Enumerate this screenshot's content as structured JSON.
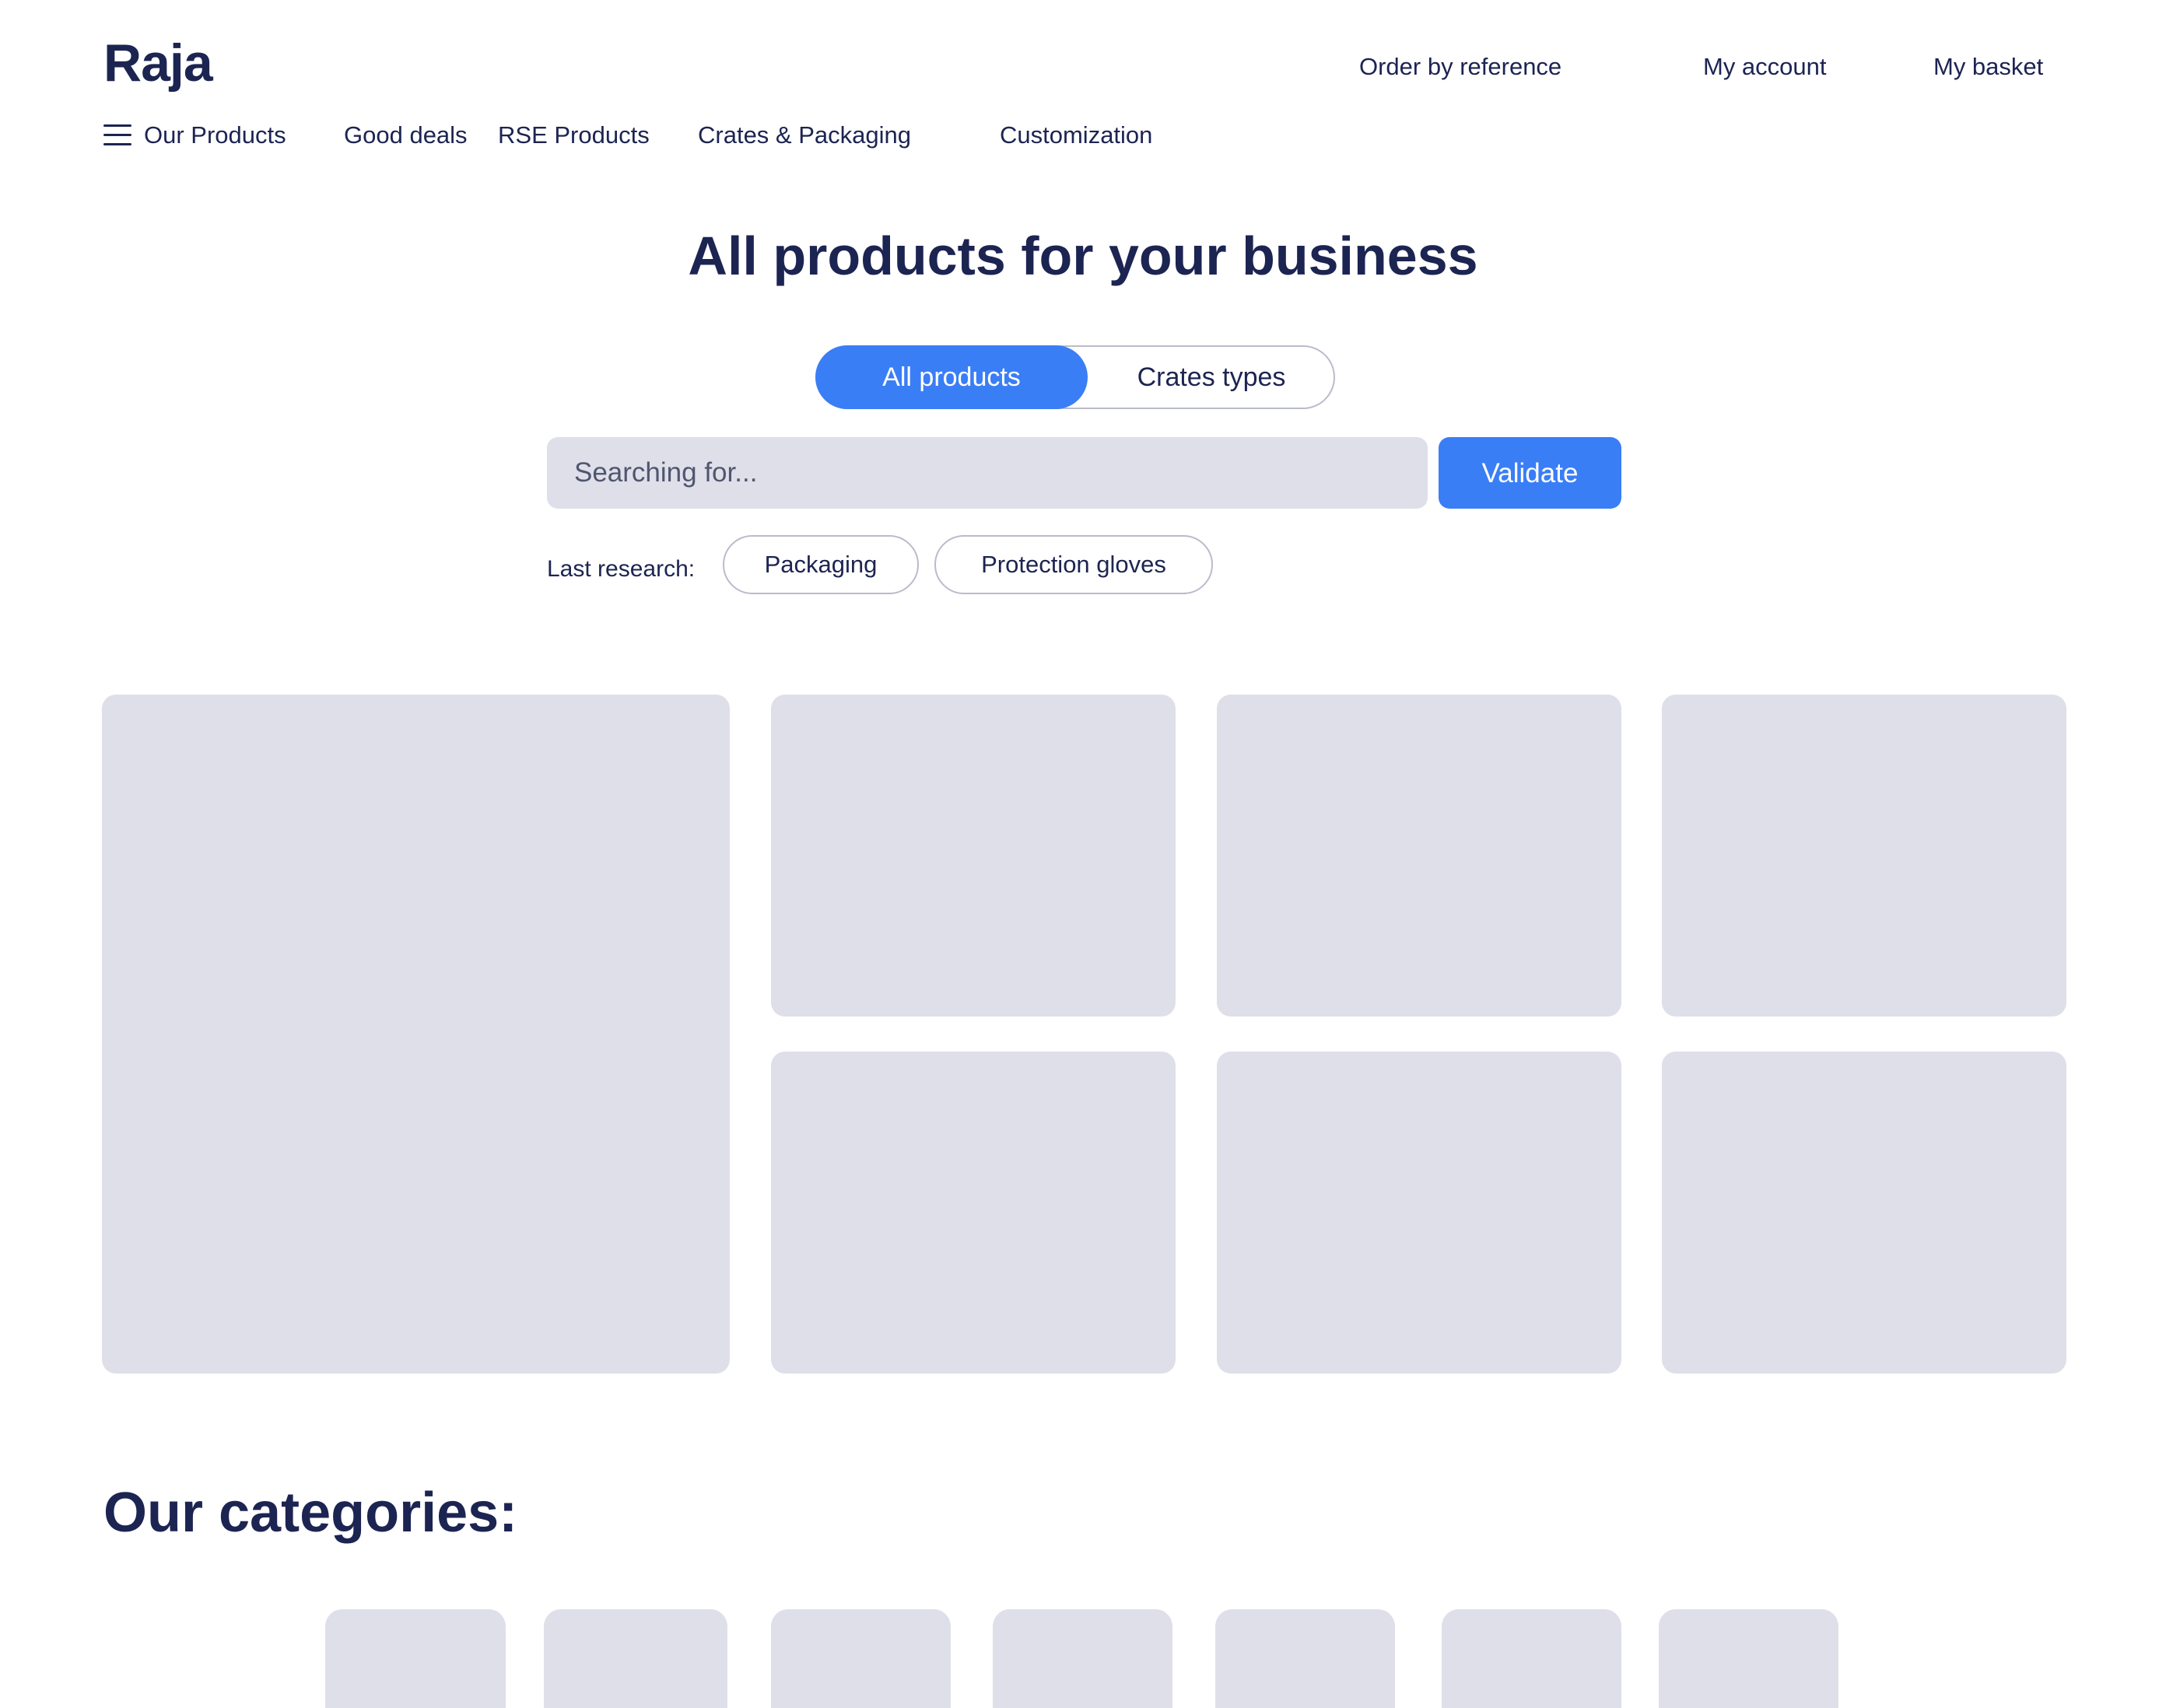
{
  "header": {
    "logo": "Raja",
    "links": {
      "order_by_reference": "Order by reference",
      "my_account": "My account",
      "my_basket": "My basket"
    }
  },
  "nav": {
    "menu_icon": "hamburger-menu-icon",
    "items": [
      "Our Products",
      "Good deals",
      "RSE Products",
      "Crates & Packaging",
      "Customization"
    ]
  },
  "hero": {
    "title": "All products for your business"
  },
  "toggle": {
    "options": [
      "All products",
      "Crates types"
    ],
    "selected": "All products"
  },
  "search": {
    "placeholder": "Searching for...",
    "value": "",
    "button_label": "Validate"
  },
  "last_research": {
    "label": "Last research:",
    "chips": [
      "Packaging",
      "Protection gloves"
    ]
  },
  "categories": {
    "title": "Our categories:"
  },
  "colors": {
    "accent": "#3a7ef6",
    "text": "#1c2452",
    "placeholder_fill": "#dfdfea",
    "border": "#b9bccb"
  }
}
